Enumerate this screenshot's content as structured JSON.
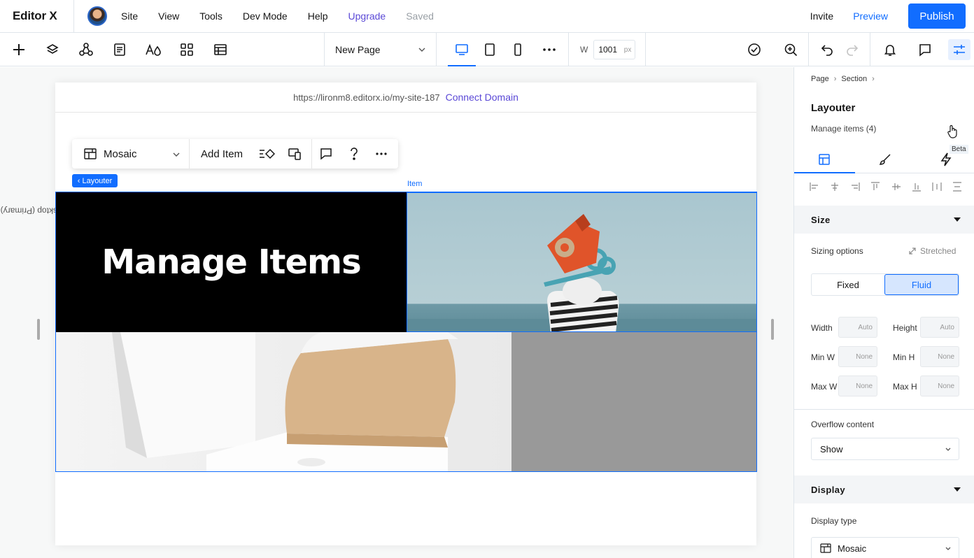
{
  "topbar": {
    "logo": "Editor X",
    "menu": [
      "Site",
      "View",
      "Tools",
      "Dev Mode",
      "Help",
      "Upgrade",
      "Saved"
    ],
    "invite": "Invite",
    "preview": "Preview",
    "publish": "Publish"
  },
  "toolbar": {
    "page_name": "New Page",
    "width_label": "W",
    "width_value": "1001",
    "width_unit": "px"
  },
  "canvas": {
    "url": "https://lironm8.editorx.io/my-site-187",
    "connect_domain": "Connect Domain",
    "breakpoint_label": "Desktop (Primary)",
    "floatbar": {
      "layout": "Mosaic",
      "add_item": "Add Item"
    },
    "layouter_tag": "Layouter",
    "item_tag": "Item",
    "headline": "Manage Items"
  },
  "panel": {
    "breadcrumb": [
      "Page",
      "Section"
    ],
    "title": "Layouter",
    "subtitle": "Manage items (4)",
    "beta": "Beta",
    "size": {
      "header": "Size",
      "sizing_options": "Sizing options",
      "stretched": "Stretched",
      "fixed": "Fixed",
      "fluid": "Fluid",
      "width_label": "Width",
      "width_value": "Auto",
      "height_label": "Height",
      "height_value": "Auto",
      "min_w_label": "Min W",
      "min_w_value": "None",
      "min_h_label": "Min H",
      "min_h_value": "None",
      "max_w_label": "Max W",
      "max_w_value": "None",
      "max_h_label": "Max H",
      "max_h_value": "None"
    },
    "overflow": {
      "label": "Overflow content",
      "value": "Show"
    },
    "display": {
      "header": "Display",
      "type_label": "Display type",
      "type_value": "Mosaic"
    }
  }
}
